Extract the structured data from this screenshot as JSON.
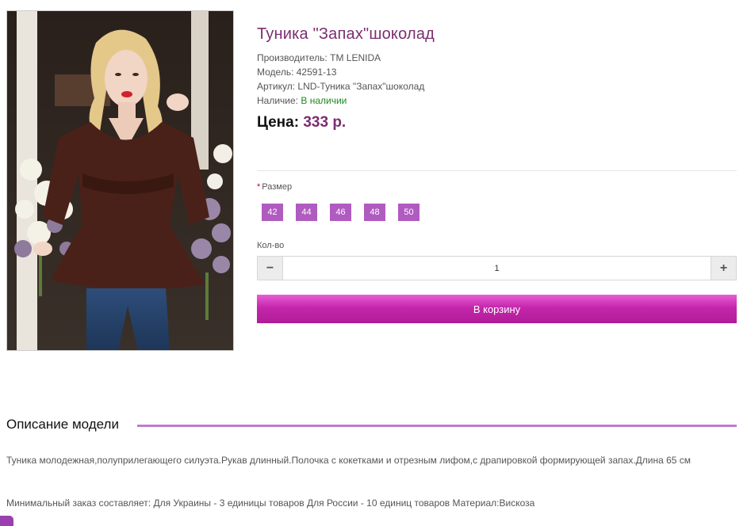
{
  "product": {
    "image_alt": "Туника \"Запах\"шоколад",
    "title": "Туника \"Запах\"шоколад",
    "specs": [
      {
        "label": "Производитель:",
        "value": "TM LENIDA"
      },
      {
        "label": "Модель:",
        "value": "42591-13"
      },
      {
        "label": "Артикул:",
        "value": "LND-Туника \"Запах\"шоколад"
      },
      {
        "label": "Наличие:",
        "value": "В наличии"
      }
    ],
    "price_label": "Цена:",
    "price_value": "333 р."
  },
  "options": {
    "size_required_mark": "*",
    "size_label": "Размер",
    "sizes": [
      "42",
      "44",
      "46",
      "48",
      "50"
    ],
    "qty_label": "Кол-во",
    "qty_value": "1",
    "qty_minus": "−",
    "qty_plus": "+",
    "cart_button": "В корзину"
  },
  "description": {
    "heading": "Описание модели",
    "text1": "Туника молодежная,полуприлегающего силуэта.Рукав длинный.Полочка с кокетками и отрезным лифом,с драпировкой формирующей запах.Длина 65 см",
    "text2": "Минимальный заказ составляет: Для Украины - 3 единицы товаров Для России - 10 единиц товаров Материал:Вискоза"
  },
  "colors": {
    "title": "#7b2d6f",
    "accent": "#b05bc0",
    "availability": "#1e8a1e",
    "cart_button": "#c426ab"
  }
}
